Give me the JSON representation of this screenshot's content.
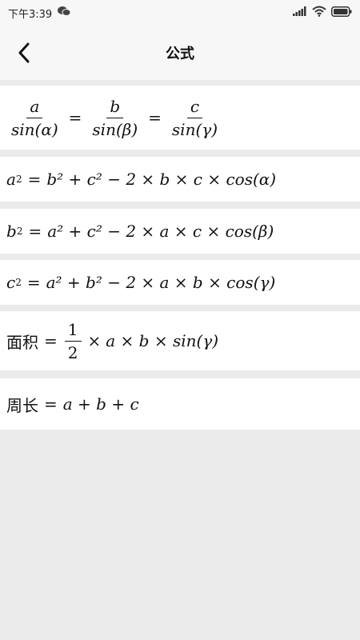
{
  "status_bar": {
    "time": "下午3:39",
    "icons": [
      "wechat-icon",
      "signal-icon",
      "wifi-icon",
      "battery-icon"
    ]
  },
  "header": {
    "title": "公式",
    "back_icon": "chevron-left-icon"
  },
  "formulas": {
    "law_of_sines": {
      "num_a": "a",
      "den_a": "sin(α)",
      "num_b": "b",
      "den_b": "sin(β)",
      "num_c": "c",
      "den_c": "sin(γ)"
    },
    "cosine_a": {
      "lhs": "a",
      "rhs": "b² + c² − 2 × b × c × cos(α)"
    },
    "cosine_b": {
      "lhs": "b",
      "rhs": "a² + c² − 2 × a × c × cos(β)"
    },
    "cosine_c": {
      "lhs": "c",
      "rhs": "a² + b² − 2 × a × b × cos(γ)"
    },
    "area": {
      "label": "面积",
      "frac_num": "1",
      "frac_den": "2",
      "rhs": "a × b × sin(γ)"
    },
    "perimeter": {
      "label": "周长",
      "rhs": "a + b + c"
    }
  },
  "colors": {
    "background": "#ebebeb",
    "card": "#ffffff",
    "bar": "#f7f7f7",
    "text": "#111111"
  }
}
